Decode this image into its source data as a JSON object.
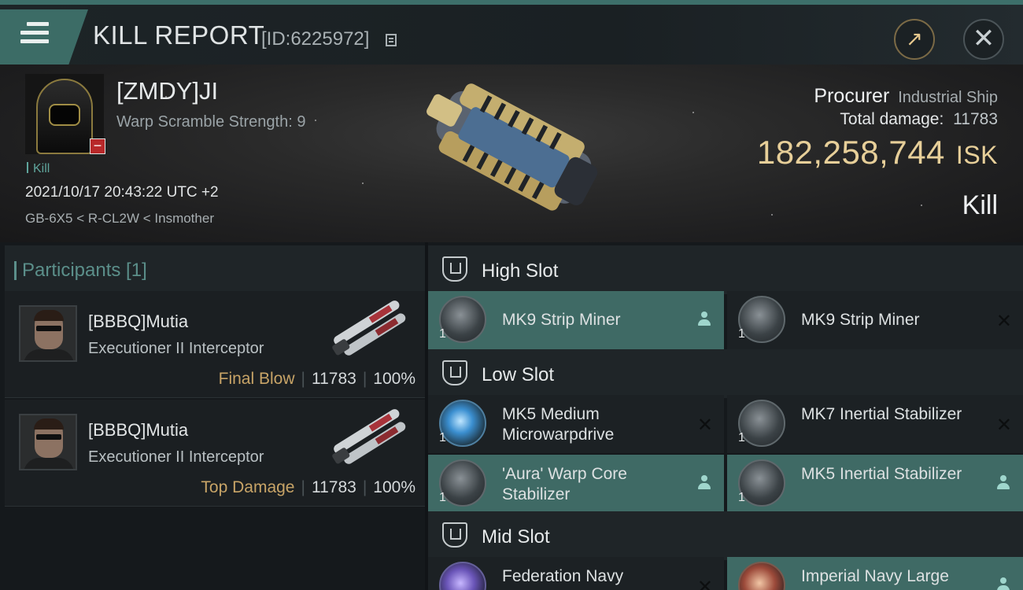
{
  "header": {
    "title": "KILL REPORT",
    "report_id": "[ID:6225972]"
  },
  "victim": {
    "name": "[ZMDY]JI",
    "warp_scramble": "Warp Scramble Strength: 9",
    "tag": "Kill",
    "datetime": "2021/10/17 20:43:22 UTC +2",
    "location": "GB-6X5 < R-CL2W < Insmother",
    "ship_name": "Procurer",
    "ship_class": "Industrial Ship",
    "total_damage_label": "Total damage:",
    "total_damage_value": "11783",
    "isk_value": "182,258,744",
    "isk_unit": "ISK",
    "result": "Kill"
  },
  "participants": {
    "title": "Participants [1]",
    "rows": [
      {
        "name": "[BBBQ]Mutia",
        "ship": "Executioner II Interceptor",
        "role": "Final Blow",
        "damage": "11783",
        "percent": "100%"
      },
      {
        "name": "[BBBQ]Mutia",
        "ship": "Executioner II Interceptor",
        "role": "Top Damage",
        "damage": "11783",
        "percent": "100%"
      }
    ]
  },
  "fitting": {
    "high_slot": {
      "label": "High Slot",
      "modules": [
        {
          "name": "MK9 Strip Miner",
          "qty": "1",
          "state": "dropped"
        },
        {
          "name": "MK9 Strip Miner",
          "qty": "1",
          "state": "destroyed"
        }
      ]
    },
    "low_slot": {
      "label": "Low Slot",
      "modules": [
        {
          "name": "MK5 Medium Microwarpdrive",
          "qty": "1",
          "state": "destroyed"
        },
        {
          "name": "MK7 Inertial Stabilizer",
          "qty": "1",
          "state": "destroyed"
        },
        {
          "name": "'Aura' Warp Core Stabilizer",
          "qty": "1",
          "state": "dropped"
        },
        {
          "name": "MK5 Inertial Stabilizer",
          "qty": "1",
          "state": "dropped"
        }
      ]
    },
    "mid_slot": {
      "label": "Mid Slot",
      "modules": [
        {
          "name": "Federation Navy",
          "qty": "1",
          "state": "destroyed"
        },
        {
          "name": "Imperial Navy Large",
          "qty": "1",
          "state": "dropped"
        }
      ]
    }
  },
  "icons": {
    "menu": "hamburger-icon",
    "copy": "copy-icon",
    "share": "share-icon",
    "close": "close-icon",
    "slot": "slot-shield-icon",
    "dropped": "person-icon",
    "destroyed": "x-icon"
  },
  "colors": {
    "accent": "#3c6c66",
    "isk": "#e7cf99",
    "final_blow": "#c8a467",
    "highlight_row": "#3f6a65"
  }
}
